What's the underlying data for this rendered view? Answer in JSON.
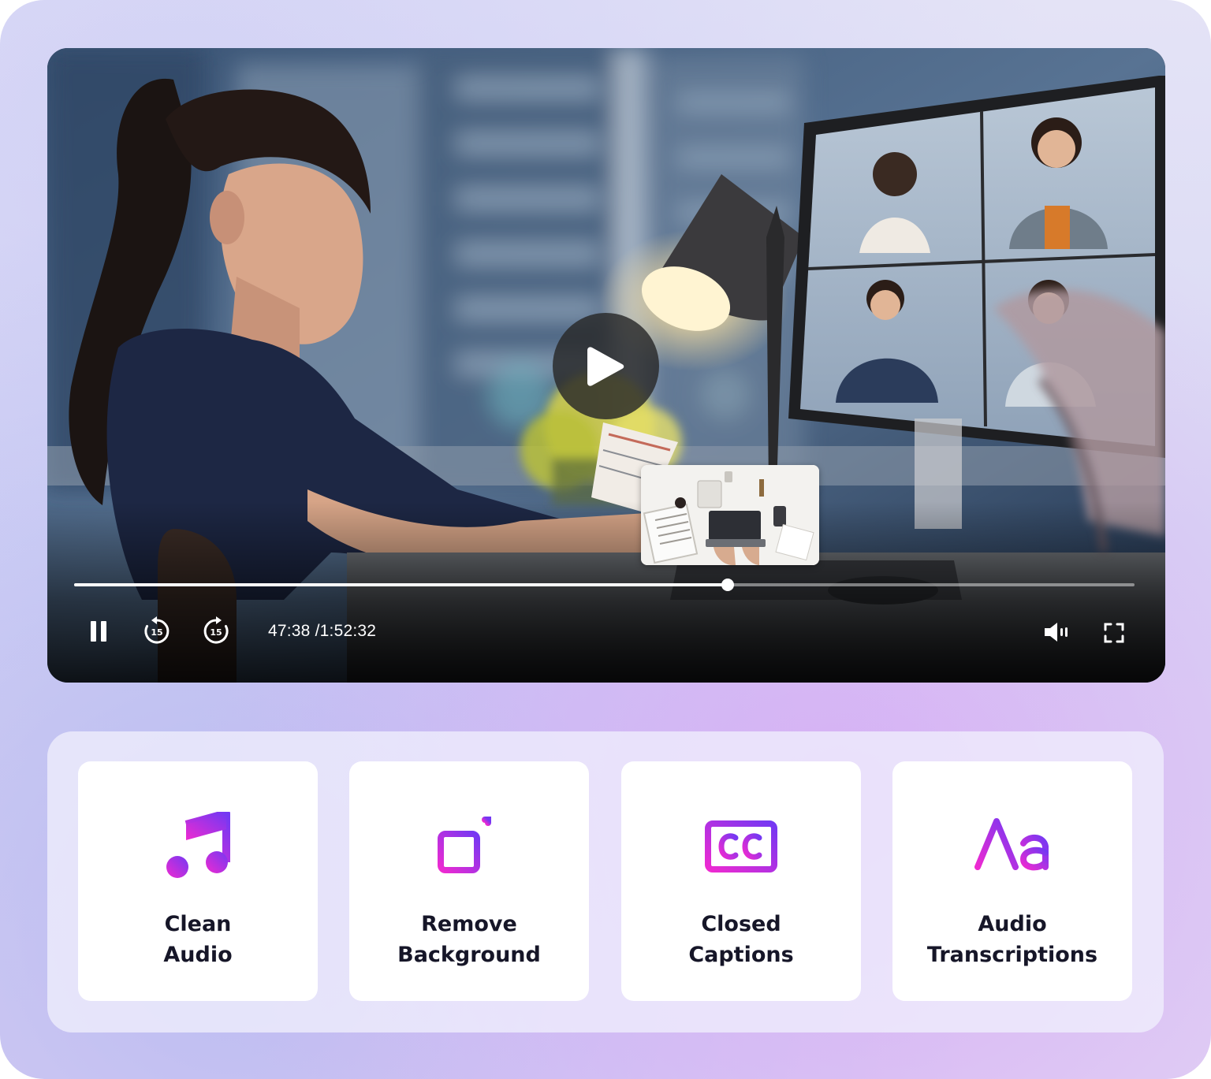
{
  "colors": {
    "accent_start": "#ec2bd3",
    "accent_end": "#7b3cf2",
    "card_text": "#161628"
  },
  "player": {
    "state": "paused-overlay",
    "current_time": "47:38",
    "separator": "/",
    "duration": "1:52:32",
    "progress_fraction": 0.616,
    "rewind_seconds": "15",
    "forward_seconds": "15",
    "icons": {
      "big_play": "play-icon",
      "pause": "pause-icon",
      "rewind": "rewind-15-icon",
      "forward": "forward-15-icon",
      "volume": "volume-icon",
      "fullscreen": "fullscreen-icon"
    }
  },
  "features": [
    {
      "line1": "Clean",
      "line2": "Audio",
      "icon": "music-note-icon"
    },
    {
      "line1": "Remove",
      "line2": "Background",
      "icon": "remove-background-icon"
    },
    {
      "line1": "Closed",
      "line2": "Captions",
      "icon": "closed-captions-icon"
    },
    {
      "line1": "Audio",
      "line2": "Transcriptions",
      "icon": "text-aa-icon"
    }
  ]
}
